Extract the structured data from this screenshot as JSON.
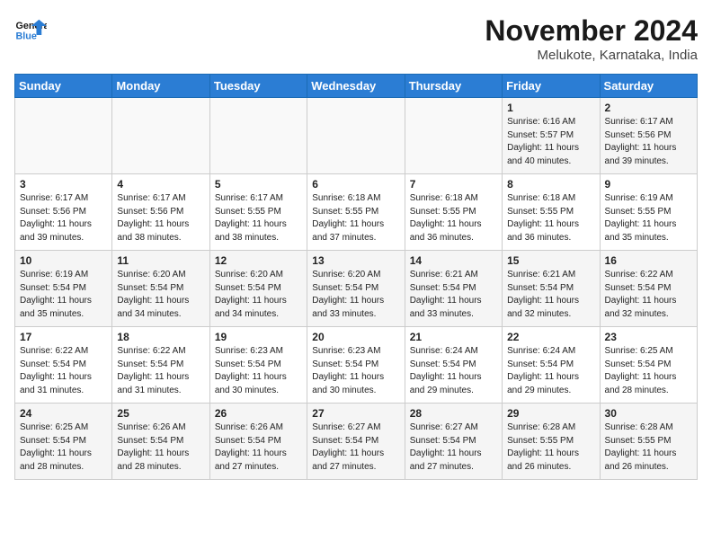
{
  "header": {
    "logo_line1": "General",
    "logo_line2": "Blue",
    "title": "November 2024",
    "subtitle": "Melukote, Karnataka, India"
  },
  "weekdays": [
    "Sunday",
    "Monday",
    "Tuesday",
    "Wednesday",
    "Thursday",
    "Friday",
    "Saturday"
  ],
  "weeks": [
    [
      {
        "day": "",
        "info": ""
      },
      {
        "day": "",
        "info": ""
      },
      {
        "day": "",
        "info": ""
      },
      {
        "day": "",
        "info": ""
      },
      {
        "day": "",
        "info": ""
      },
      {
        "day": "1",
        "info": "Sunrise: 6:16 AM\nSunset: 5:57 PM\nDaylight: 11 hours\nand 40 minutes."
      },
      {
        "day": "2",
        "info": "Sunrise: 6:17 AM\nSunset: 5:56 PM\nDaylight: 11 hours\nand 39 minutes."
      }
    ],
    [
      {
        "day": "3",
        "info": "Sunrise: 6:17 AM\nSunset: 5:56 PM\nDaylight: 11 hours\nand 39 minutes."
      },
      {
        "day": "4",
        "info": "Sunrise: 6:17 AM\nSunset: 5:56 PM\nDaylight: 11 hours\nand 38 minutes."
      },
      {
        "day": "5",
        "info": "Sunrise: 6:17 AM\nSunset: 5:55 PM\nDaylight: 11 hours\nand 38 minutes."
      },
      {
        "day": "6",
        "info": "Sunrise: 6:18 AM\nSunset: 5:55 PM\nDaylight: 11 hours\nand 37 minutes."
      },
      {
        "day": "7",
        "info": "Sunrise: 6:18 AM\nSunset: 5:55 PM\nDaylight: 11 hours\nand 36 minutes."
      },
      {
        "day": "8",
        "info": "Sunrise: 6:18 AM\nSunset: 5:55 PM\nDaylight: 11 hours\nand 36 minutes."
      },
      {
        "day": "9",
        "info": "Sunrise: 6:19 AM\nSunset: 5:55 PM\nDaylight: 11 hours\nand 35 minutes."
      }
    ],
    [
      {
        "day": "10",
        "info": "Sunrise: 6:19 AM\nSunset: 5:54 PM\nDaylight: 11 hours\nand 35 minutes."
      },
      {
        "day": "11",
        "info": "Sunrise: 6:20 AM\nSunset: 5:54 PM\nDaylight: 11 hours\nand 34 minutes."
      },
      {
        "day": "12",
        "info": "Sunrise: 6:20 AM\nSunset: 5:54 PM\nDaylight: 11 hours\nand 34 minutes."
      },
      {
        "day": "13",
        "info": "Sunrise: 6:20 AM\nSunset: 5:54 PM\nDaylight: 11 hours\nand 33 minutes."
      },
      {
        "day": "14",
        "info": "Sunrise: 6:21 AM\nSunset: 5:54 PM\nDaylight: 11 hours\nand 33 minutes."
      },
      {
        "day": "15",
        "info": "Sunrise: 6:21 AM\nSunset: 5:54 PM\nDaylight: 11 hours\nand 32 minutes."
      },
      {
        "day": "16",
        "info": "Sunrise: 6:22 AM\nSunset: 5:54 PM\nDaylight: 11 hours\nand 32 minutes."
      }
    ],
    [
      {
        "day": "17",
        "info": "Sunrise: 6:22 AM\nSunset: 5:54 PM\nDaylight: 11 hours\nand 31 minutes."
      },
      {
        "day": "18",
        "info": "Sunrise: 6:22 AM\nSunset: 5:54 PM\nDaylight: 11 hours\nand 31 minutes."
      },
      {
        "day": "19",
        "info": "Sunrise: 6:23 AM\nSunset: 5:54 PM\nDaylight: 11 hours\nand 30 minutes."
      },
      {
        "day": "20",
        "info": "Sunrise: 6:23 AM\nSunset: 5:54 PM\nDaylight: 11 hours\nand 30 minutes."
      },
      {
        "day": "21",
        "info": "Sunrise: 6:24 AM\nSunset: 5:54 PM\nDaylight: 11 hours\nand 29 minutes."
      },
      {
        "day": "22",
        "info": "Sunrise: 6:24 AM\nSunset: 5:54 PM\nDaylight: 11 hours\nand 29 minutes."
      },
      {
        "day": "23",
        "info": "Sunrise: 6:25 AM\nSunset: 5:54 PM\nDaylight: 11 hours\nand 28 minutes."
      }
    ],
    [
      {
        "day": "24",
        "info": "Sunrise: 6:25 AM\nSunset: 5:54 PM\nDaylight: 11 hours\nand 28 minutes."
      },
      {
        "day": "25",
        "info": "Sunrise: 6:26 AM\nSunset: 5:54 PM\nDaylight: 11 hours\nand 28 minutes."
      },
      {
        "day": "26",
        "info": "Sunrise: 6:26 AM\nSunset: 5:54 PM\nDaylight: 11 hours\nand 27 minutes."
      },
      {
        "day": "27",
        "info": "Sunrise: 6:27 AM\nSunset: 5:54 PM\nDaylight: 11 hours\nand 27 minutes."
      },
      {
        "day": "28",
        "info": "Sunrise: 6:27 AM\nSunset: 5:54 PM\nDaylight: 11 hours\nand 27 minutes."
      },
      {
        "day": "29",
        "info": "Sunrise: 6:28 AM\nSunset: 5:55 PM\nDaylight: 11 hours\nand 26 minutes."
      },
      {
        "day": "30",
        "info": "Sunrise: 6:28 AM\nSunset: 5:55 PM\nDaylight: 11 hours\nand 26 minutes."
      }
    ]
  ]
}
